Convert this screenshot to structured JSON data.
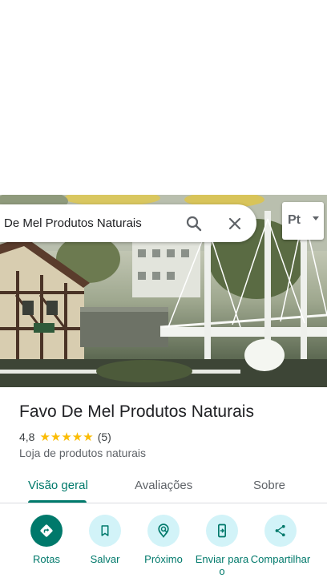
{
  "search": {
    "query": "De Mel Produtos Naturais"
  },
  "language_button": {
    "label": "Pt"
  },
  "place": {
    "title": "Favo De Mel Produtos Naturais",
    "rating": "4,8",
    "stars": "★★★★★",
    "review_count": "(5)",
    "category": "Loja de produtos naturais"
  },
  "tabs": [
    {
      "label": "Visão geral",
      "active": true
    },
    {
      "label": "Avaliações",
      "active": false
    },
    {
      "label": "Sobre",
      "active": false
    }
  ],
  "actions": [
    {
      "label": "Rotas",
      "icon": "directions-icon"
    },
    {
      "label": "Salvar",
      "icon": "bookmark-icon"
    },
    {
      "label": "Próximo",
      "icon": "nearby-icon"
    },
    {
      "label": "Enviar para o",
      "icon": "send-to-phone-icon"
    },
    {
      "label": "Compartilhar",
      "icon": "share-icon"
    }
  ],
  "colors": {
    "accent": "#00796b",
    "action_bg": "#d2f3f8",
    "star": "#fbbc04",
    "text_primary": "#202124",
    "text_secondary": "#5f6368"
  }
}
